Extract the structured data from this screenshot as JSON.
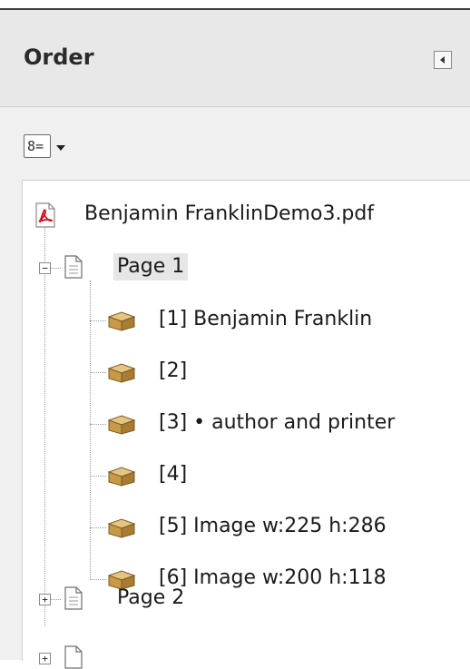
{
  "panel": {
    "title": "Order",
    "collapse_icon": "collapse-left-icon",
    "options_icon": "order-options-icon",
    "options_glyph": "8="
  },
  "tree": {
    "document": {
      "label": "Benjamin FranklinDemo3.pdf",
      "icon": "pdf-file-icon"
    },
    "pages": [
      {
        "label": "Page 1",
        "expanded": true,
        "items": [
          {
            "label": "[1]  Benjamin Franklin"
          },
          {
            "label": "[2]"
          },
          {
            "label": "[3]  • author and printer"
          },
          {
            "label": "[4]"
          },
          {
            "label": "[5] Image   w:225 h:286"
          },
          {
            "label": "[6] Image   w:200 h:118"
          }
        ]
      },
      {
        "label": "Page 2",
        "expanded": false,
        "items": []
      }
    ]
  },
  "colors": {
    "panel_bg": "#f0f0f0",
    "tree_bg": "#ffffff",
    "selection_bg": "#e6e6e6",
    "pdf_red": "#d2141e",
    "box_tan": "#c79a45"
  }
}
